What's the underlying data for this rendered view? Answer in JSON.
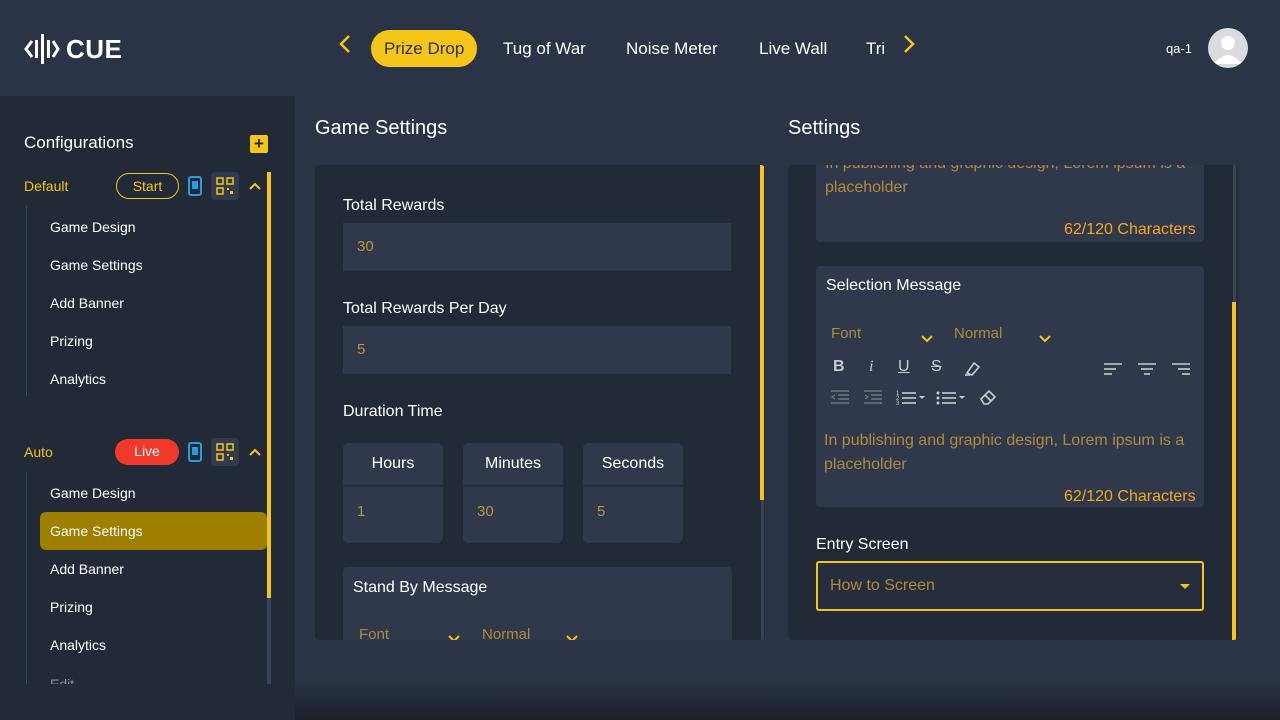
{
  "app": {
    "logo_text": "CUE"
  },
  "header": {
    "tabs": [
      {
        "label": "Prize Drop",
        "active": true
      },
      {
        "label": "Tug of War",
        "active": false
      },
      {
        "label": "Noise Meter",
        "active": false
      },
      {
        "label": "Live Wall",
        "active": false
      },
      {
        "label": "Tri",
        "active": false
      }
    ],
    "user": "qa-1"
  },
  "sidebar": {
    "title": "Configurations",
    "add_icon": "plus-icon",
    "groups": [
      {
        "name": "Default",
        "status": "Start",
        "items": [
          "Game Design",
          "Game Settings",
          "Add Banner",
          "Prizing",
          "Analytics"
        ]
      },
      {
        "name": "Auto",
        "status": "Live",
        "items": [
          "Game Design",
          "Game Settings",
          "Add Banner",
          "Prizing",
          "Analytics",
          "Edit"
        ],
        "active_item": "Game Settings"
      }
    ]
  },
  "game_settings": {
    "title": "Game Settings",
    "total_rewards_label": "Total Rewards",
    "total_rewards_value": "30",
    "per_day_label": "Total Rewards Per Day",
    "per_day_value": "5",
    "duration_label": "Duration Time",
    "hours_label": "Hours",
    "hours_value": "1",
    "minutes_label": "Minutes",
    "minutes_value": "30",
    "seconds_label": "Seconds",
    "seconds_value": "5",
    "standby_label": "Stand By Message",
    "font_select": "Font",
    "size_select": "Normal"
  },
  "settings": {
    "title": "Settings",
    "top_text": "In publishing and graphic design, Lorem ipsum is a placeholder",
    "top_chars": "62/120 Characters",
    "selection_label": "Selection Message",
    "font_select": "Font",
    "size_select": "Normal",
    "selection_text": "In publishing and graphic design, Lorem ipsum is a placeholder",
    "selection_chars": "62/120 Characters",
    "entry_label": "Entry Screen",
    "entry_value": "How to Screen"
  },
  "colors": {
    "accent": "#f5c518",
    "live": "#f0392b",
    "bg": "#2b3446",
    "panel": "#222a38"
  }
}
